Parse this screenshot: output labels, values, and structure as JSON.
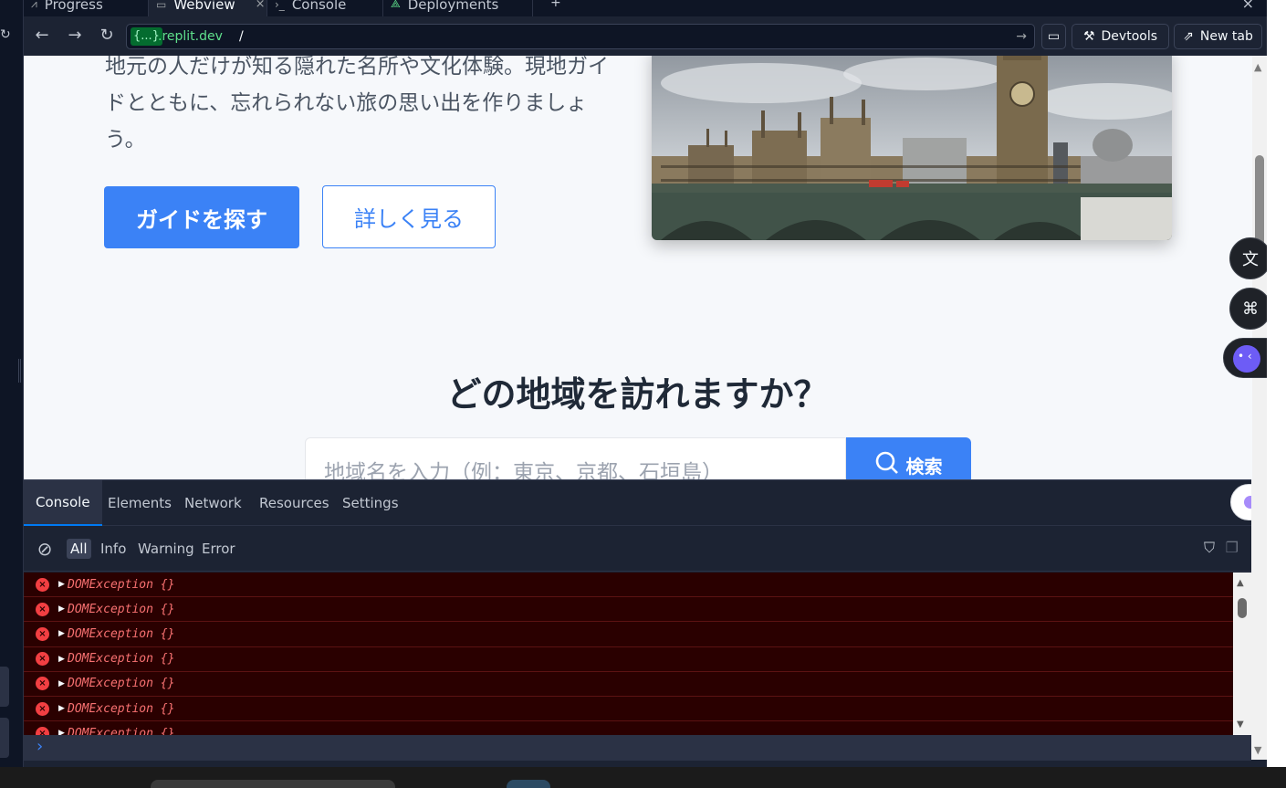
{
  "tabs": [
    {
      "label": "Progress",
      "icon": "chart-line-icon"
    },
    {
      "label": "Webview",
      "icon": "monitor-icon",
      "active": true
    },
    {
      "label": "Console",
      "icon": "terminal-icon"
    },
    {
      "label": "Deployments",
      "icon": "deploy-icon"
    }
  ],
  "address": {
    "host_pill": "{...}",
    "host": ".replit.dev",
    "path": "/"
  },
  "toolbar": {
    "devtools_label": "Devtools",
    "newtab_label": "New tab"
  },
  "page": {
    "hero_text": "地元の人だけが知る隠れた名所や文化体験。現地ガイドとともに、忘れられない旅の思い出を作りましょう。",
    "primary_button": "ガイドを探す",
    "secondary_button": "詳しく見る",
    "section_title": "どの地域を訪れますか？",
    "search_placeholder": "地域名を入力（例：東京、京都、石垣島）",
    "search_button": "検索"
  },
  "devtools": {
    "tabs": [
      "Console",
      "Elements",
      "Network",
      "Resources",
      "Settings"
    ],
    "filters": [
      "All",
      "Info",
      "Warning",
      "Error"
    ],
    "logs": [
      "DOMException {}",
      "DOMException {}",
      "DOMException {}",
      "DOMException {}",
      "DOMException {}",
      "DOMException {}",
      "DOMException {}"
    ]
  },
  "colors": {
    "accent": "#3b82f6",
    "error_bg": "#2a0000",
    "error_text": "#f87171"
  }
}
